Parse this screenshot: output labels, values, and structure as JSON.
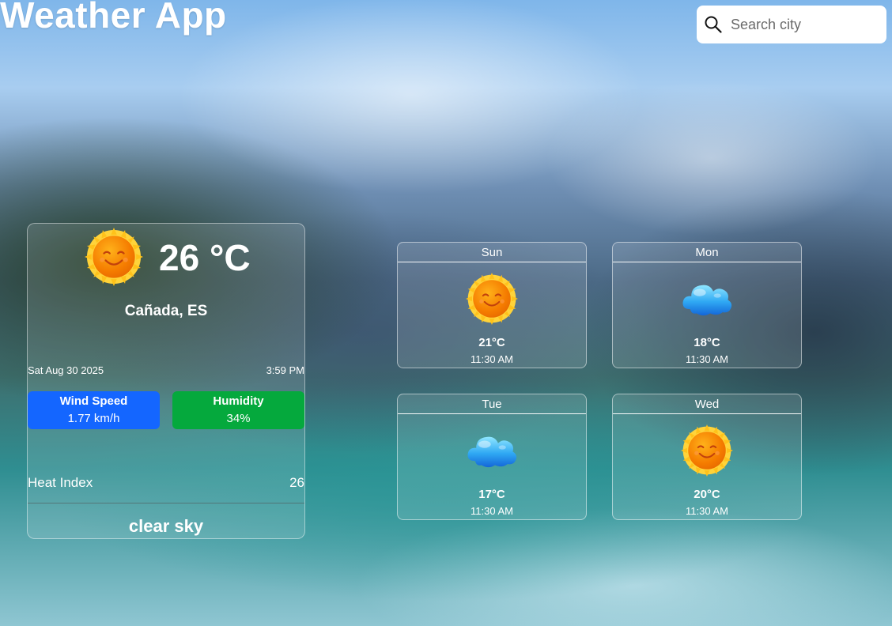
{
  "header": {
    "title": "Weather App"
  },
  "search": {
    "placeholder": "Search city",
    "icon": "search-icon"
  },
  "current": {
    "icon": "sun-icon",
    "temperature": "26 °C",
    "location": "Cañada, ES",
    "date": "Sat Aug 30 2025",
    "time": "3:59 PM",
    "wind": {
      "label": "Wind Speed",
      "value": "1.77 km/h",
      "color": "#1466ff"
    },
    "humidity": {
      "label": "Humidity",
      "value": "34%",
      "color": "#05a93d"
    },
    "heat_index": {
      "label": "Heat Index",
      "value": "26"
    },
    "description": "clear sky"
  },
  "forecast": [
    {
      "day": "Sun",
      "icon": "sun-icon",
      "temp": "21°C",
      "time": "11:30 AM"
    },
    {
      "day": "Mon",
      "icon": "cloud-icon",
      "temp": "18°C",
      "time": "11:30 AM"
    },
    {
      "day": "Tue",
      "icon": "cloud-icon",
      "temp": "17°C",
      "time": "11:30 AM"
    },
    {
      "day": "Wed",
      "icon": "sun-icon",
      "temp": "20°C",
      "time": "11:30 AM"
    }
  ]
}
